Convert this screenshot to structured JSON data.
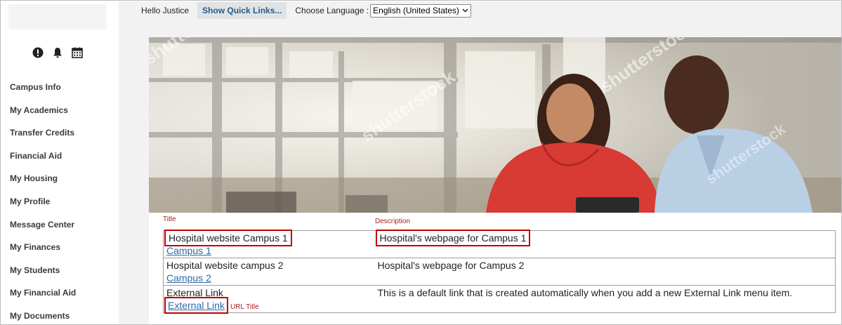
{
  "sidebar": {
    "icons": [
      "alert-icon",
      "bell-icon",
      "calendar-icon"
    ],
    "items": [
      {
        "label": "Campus Info"
      },
      {
        "label": "My Academics"
      },
      {
        "label": "Transfer Credits"
      },
      {
        "label": "Financial Aid"
      },
      {
        "label": "My Housing"
      },
      {
        "label": "My Profile"
      },
      {
        "label": "Message Center"
      },
      {
        "label": "My Finances"
      },
      {
        "label": "My Students"
      },
      {
        "label": "My Financial Aid"
      },
      {
        "label": "My Documents"
      }
    ]
  },
  "topbar": {
    "greeting": "Hello Justice",
    "quick_links": "Show Quick Links...",
    "language_label": "Choose Language :",
    "language_value": "English (United States)"
  },
  "hero": {
    "watermark": "shutterstock"
  },
  "annotations": {
    "title_label": "Title",
    "description_label": "Description",
    "url_title_label": "URL Title"
  },
  "links": [
    {
      "title": "Hospital website Campus 1",
      "url_text": "Campus 1",
      "description": "Hospital's webpage for Campus 1"
    },
    {
      "title": "Hospital website campus 2",
      "url_text": "Campus 2",
      "description": "Hospital's webpage for Campus 2"
    },
    {
      "title": "External Link",
      "url_text": "External Link",
      "description": "This is a default link that is created automatically when you add a new External Link menu item."
    }
  ],
  "colors": {
    "highlight": "#c00000",
    "link": "#2e6aa6",
    "annotation": "#a52020",
    "background": "#f2f2f2"
  }
}
